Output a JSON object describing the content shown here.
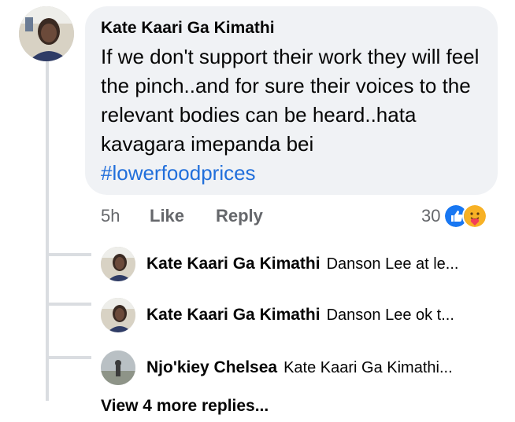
{
  "comment": {
    "author": "Kate Kaari Ga Kimathi",
    "text": "If we don't support their work they will feel the pinch..and for sure their voices to the relevant bodies can be heard..hata kavagara imepanda bei",
    "hashtag": "#lowerfoodprices",
    "time": "5h",
    "like_label": "Like",
    "reply_label": "Reply",
    "reaction_count": "30",
    "reaction_icons": [
      "like-icon",
      "care-icon"
    ]
  },
  "replies": [
    {
      "author": "Kate Kaari Ga Kimathi",
      "snippet": "Danson Lee at le..."
    },
    {
      "author": "Kate Kaari Ga Kimathi",
      "snippet": "Danson Lee ok t..."
    },
    {
      "author": "Njo'kiey Chelsea",
      "snippet": "Kate Kaari Ga Kimathi..."
    }
  ],
  "view_more_label": "View 4 more replies...",
  "colors": {
    "bubble": "#f0f2f5",
    "link": "#216fdb",
    "secondary": "#65676b",
    "line": "#dadde1"
  }
}
